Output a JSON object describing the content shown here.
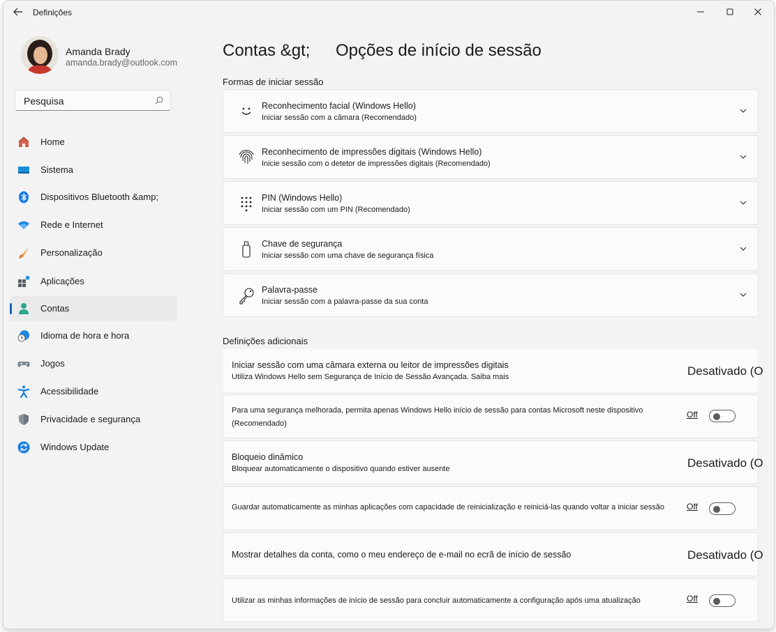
{
  "window": {
    "title": "Definições",
    "back_icon": "back-arrow-icon",
    "controls": [
      "minimize-icon",
      "maximize-icon",
      "close-icon"
    ]
  },
  "user": {
    "name": "Amanda Brady",
    "email": "amanda.brady@outlook.com"
  },
  "search": {
    "placeholder": "Pesquisa",
    "value": ""
  },
  "nav": {
    "items": [
      {
        "label": "Home",
        "icon": "home-icon"
      },
      {
        "label": "Sistema",
        "icon": "system-icon"
      },
      {
        "label": "Dispositivos Bluetooth &amp;",
        "icon": "bluetooth-icon"
      },
      {
        "label": "Rede e Internet",
        "icon": "wifi-icon"
      },
      {
        "label": "Personalização",
        "icon": "brush-icon"
      },
      {
        "label": "Aplicações",
        "icon": "apps-icon"
      },
      {
        "label": "Contas",
        "icon": "accounts-icon",
        "selected": true
      },
      {
        "label": "Idioma de hora e hora",
        "icon": "time-language-icon"
      },
      {
        "label": "Jogos",
        "icon": "gamepad-icon"
      },
      {
        "label": "Acessibilidade",
        "icon": "accessibility-icon"
      },
      {
        "label": "Privacidade e segurança",
        "icon": "shield-icon"
      },
      {
        "label": "Windows Update",
        "icon": "update-icon"
      }
    ]
  },
  "page": {
    "breadcrumb_parent": "Contas &gt;",
    "breadcrumb_current": "Opções de início de sessão"
  },
  "sign_in_ways": {
    "heading": "Formas de iniciar sessão",
    "items": [
      {
        "title": "Reconhecimento facial (Windows Hello)",
        "subtitle": "Iniciar sessão com a câmara (Recomendado)",
        "icon": "face-icon"
      },
      {
        "title": "Reconhecimento de impressões digitais (Windows Hello)",
        "subtitle": "Inicie sessão com o detetor de impressões digitais (Recomendado)",
        "icon": "fingerprint-icon"
      },
      {
        "title": "PIN (Windows Hello)",
        "subtitle": "Iniciar sessão com um PIN (Recomendado)",
        "icon": "keypad-icon"
      },
      {
        "title": "Chave de segurança",
        "subtitle": "Iniciar sessão com uma chave de segurança física",
        "icon": "usb-key-icon"
      },
      {
        "title": "Palavra-passe",
        "subtitle": "Iniciar sessão com a palavra-passe da sua conta",
        "icon": "key-icon"
      }
    ]
  },
  "additional": {
    "heading": "Definições adicionais",
    "items": [
      {
        "title": "Iniciar sessão com uma câmara externa ou leitor de impressões digitais",
        "subtitle": "Utiliza Windows Hello sem Segurança de Início de Sessão Avançada. Saiba mais",
        "status": "Desativado (O"
      },
      {
        "text": "Para uma segurança melhorada, permita apenas Windows Hello início de sessão para contas Microsoft neste dispositivo (Recomendado)",
        "toggle_label": "Off",
        "toggle_on": false
      },
      {
        "title": "Bloqueio dinâmico",
        "subtitle": "Bloquear automaticamente o dispositivo quando estiver ausente",
        "status": "Desativado (O"
      },
      {
        "text": "Guardar automaticamente as minhas aplicações com capacidade de reinicialização e reiniciá-las quando voltar a iniciar sessão",
        "toggle_label": "Off",
        "toggle_on": false
      },
      {
        "title": "Mostrar detalhes da conta, como o meu endereço de e-mail no ecrã de início de sessão",
        "status": "Desativado (O"
      },
      {
        "text": "Utilizar as minhas informações de início de sessão para concluir automaticamente a configuração após uma atualização",
        "toggle_label": "Off",
        "toggle_on": false
      }
    ]
  },
  "colors": {
    "accent": "#0067c0",
    "window_bg": "#f3f3f3",
    "card_bg": "#fbfbfb"
  }
}
